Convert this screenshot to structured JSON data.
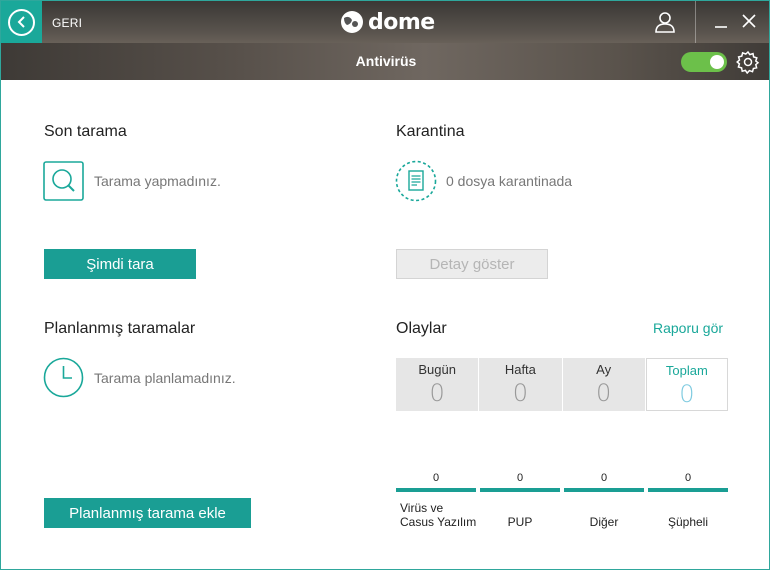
{
  "header": {
    "back_label": "GERI",
    "logo_text": "dome",
    "title": "Antivirüs",
    "toggle_on": true
  },
  "last_scan": {
    "title": "Son tarama",
    "status": "Tarama yapmadınız.",
    "button": "Şimdi tara"
  },
  "quarantine": {
    "title": "Karantina",
    "status": "0 dosya karantinada",
    "button": "Detay göster"
  },
  "scheduled": {
    "title": "Planlanmış taramalar",
    "status": "Tarama planlamadınız.",
    "button": "Planlanmış tarama ekle"
  },
  "events": {
    "title": "Olaylar",
    "report_link": "Raporu gör",
    "periods": [
      {
        "label": "Bugün",
        "value": "0"
      },
      {
        "label": "Hafta",
        "value": "0"
      },
      {
        "label": "Ay",
        "value": "0"
      },
      {
        "label": "Toplam",
        "value": "0"
      }
    ],
    "categories": [
      {
        "count": "0",
        "label_line1": "Virüs ve",
        "label_line2": "Casus Yazılım"
      },
      {
        "count": "0",
        "label_line1": "PUP",
        "label_line2": ""
      },
      {
        "count": "0",
        "label_line1": "Diğer",
        "label_line2": ""
      },
      {
        "count": "0",
        "label_line1": "Şüpheli",
        "label_line2": ""
      }
    ]
  },
  "colors": {
    "accent": "#1aa89a",
    "toggle": "#6cc04a"
  }
}
